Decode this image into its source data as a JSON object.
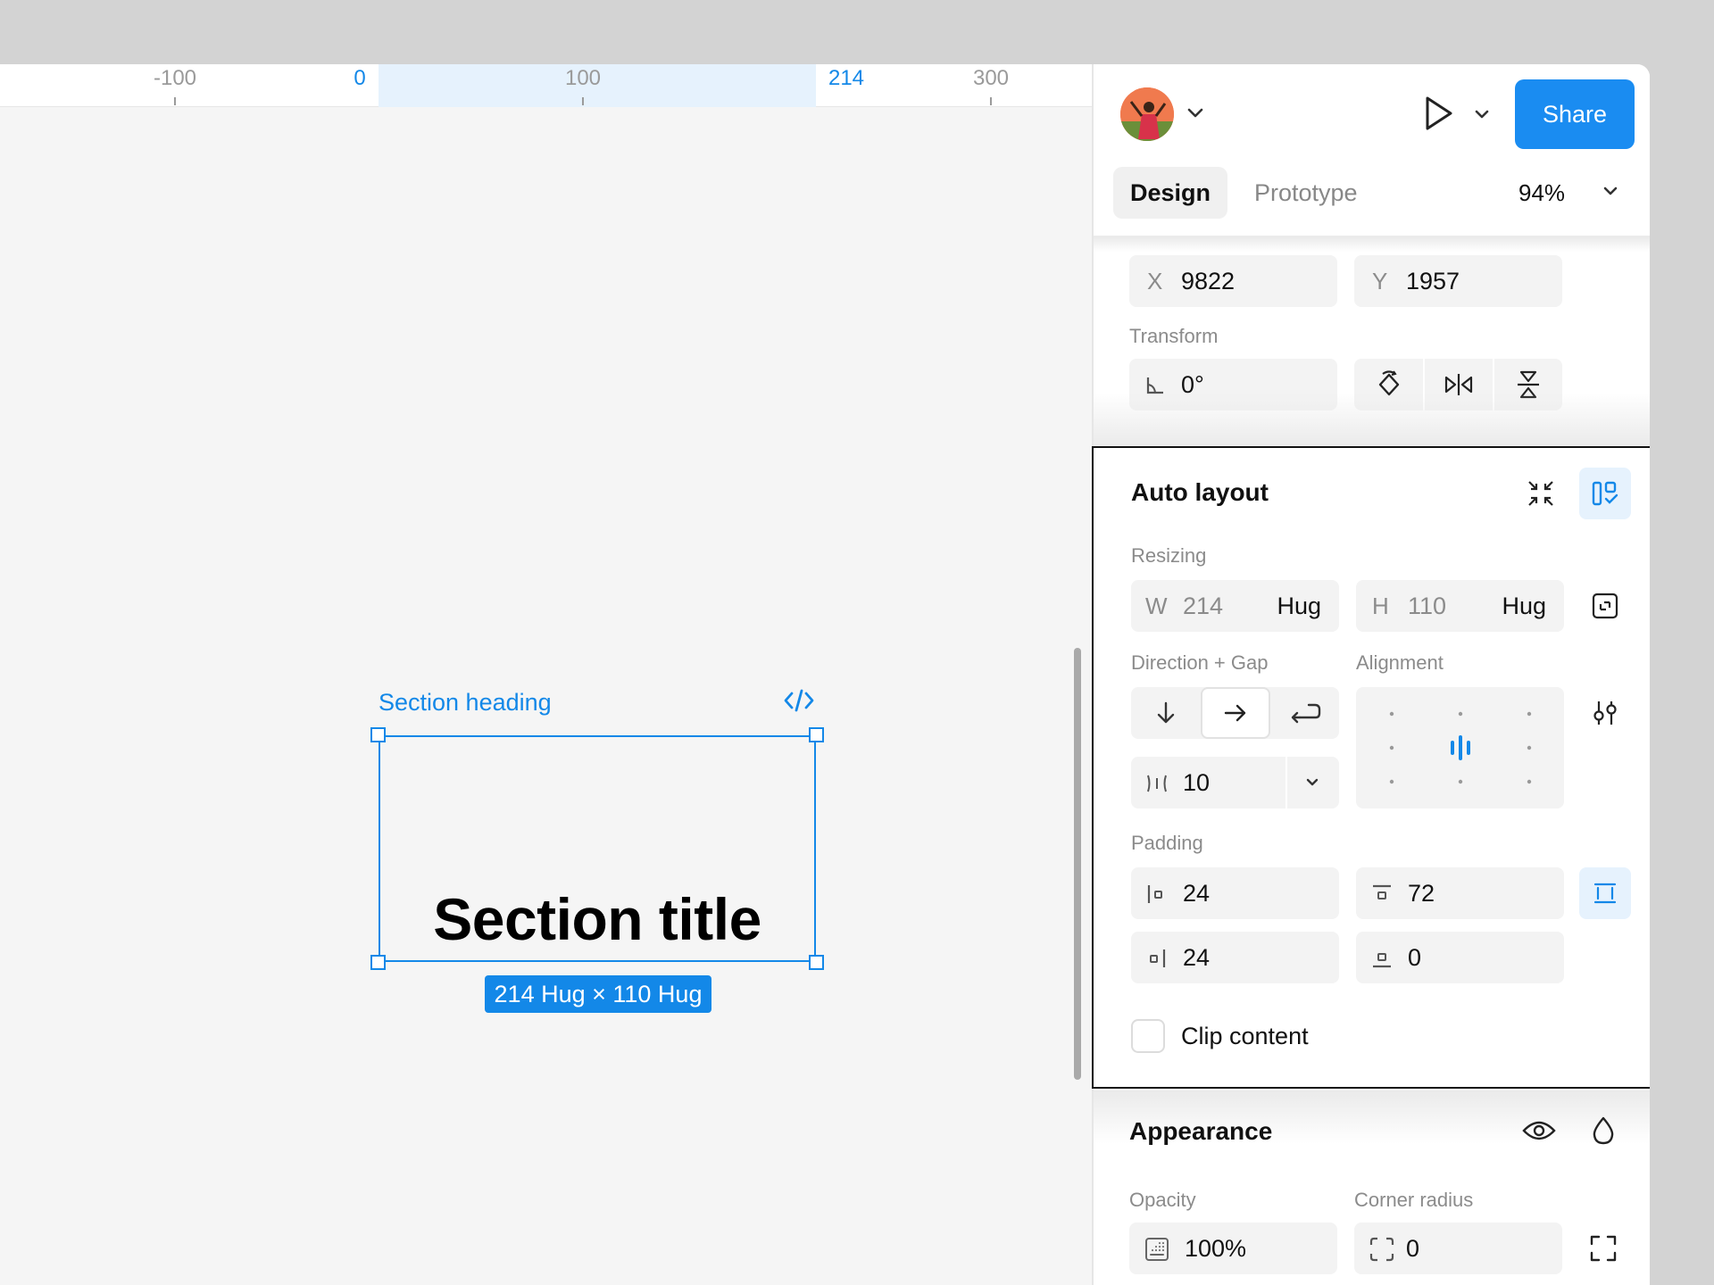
{
  "ruler": {
    "ticks": [
      {
        "label": "-100",
        "active": false
      },
      {
        "label": "0",
        "active": true
      },
      {
        "label": "100",
        "active": false
      },
      {
        "label": "214",
        "active": true
      },
      {
        "label": "300",
        "active": false
      }
    ]
  },
  "canvas": {
    "selection_label": "Section heading",
    "frame_title": "Section title",
    "size_badge": "214 Hug × 110 Hug",
    "accent": "#1388e8"
  },
  "header": {
    "share_label": "Share",
    "tabs": [
      {
        "label": "Design",
        "active": true
      },
      {
        "label": "Prototype",
        "active": false
      }
    ],
    "zoom": "94%"
  },
  "position": {
    "x_prefix": "X",
    "x": "9822",
    "y_prefix": "Y",
    "y": "1957"
  },
  "transform": {
    "label": "Transform",
    "rotation": "0°"
  },
  "auto_layout": {
    "title": "Auto layout",
    "resizing_label": "Resizing",
    "w_prefix": "W",
    "w": "214",
    "w_mode": "Hug",
    "h_prefix": "H",
    "h": "110",
    "h_mode": "Hug",
    "direction_label": "Direction + Gap",
    "alignment_label": "Alignment",
    "gap": "10",
    "padding_label": "Padding",
    "padding_left": "24",
    "padding_top": "72",
    "padding_right": "24",
    "padding_bottom": "0",
    "clip_label": "Clip content"
  },
  "appearance": {
    "title": "Appearance",
    "opacity_label": "Opacity",
    "opacity": "100%",
    "radius_label": "Corner radius",
    "radius": "0"
  }
}
